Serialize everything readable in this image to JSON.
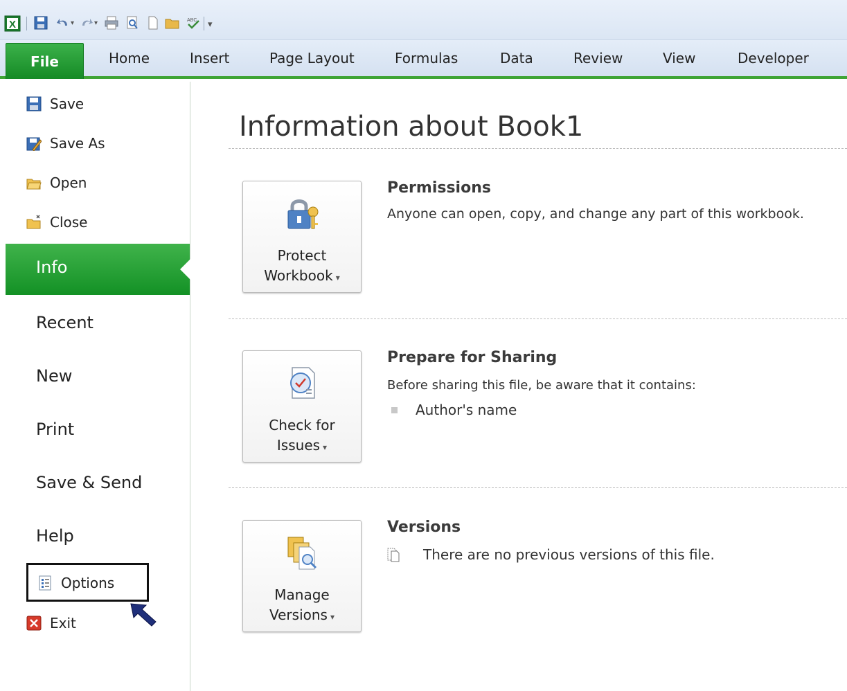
{
  "ribbon": {
    "file_tab": "File",
    "tabs": [
      "Home",
      "Insert",
      "Page Layout",
      "Formulas",
      "Data",
      "Review",
      "View",
      "Developer"
    ]
  },
  "backstage": {
    "commands": [
      "Save",
      "Save As",
      "Open",
      "Close"
    ],
    "selected_tab": "Info",
    "tabs": [
      "Recent",
      "New",
      "Print",
      "Save & Send",
      "Help"
    ],
    "bottom_commands": [
      "Options",
      "Exit"
    ]
  },
  "info": {
    "title": "Information about Book1",
    "permissions": {
      "button_line1": "Protect",
      "button_line2": "Workbook",
      "heading": "Permissions",
      "description": "Anyone can open, copy, and change any part of this workbook."
    },
    "sharing": {
      "button_line1": "Check for",
      "button_line2": "Issues",
      "heading": "Prepare for Sharing",
      "description": "Before sharing this file, be aware that it contains:",
      "items": [
        "Author's name"
      ]
    },
    "versions": {
      "button_line1": "Manage",
      "button_line2": "Versions",
      "heading": "Versions",
      "description": "There are no previous versions of this file."
    }
  },
  "colors": {
    "accent_green": "#139125",
    "ribbon_blue": "#dbe6f4"
  }
}
